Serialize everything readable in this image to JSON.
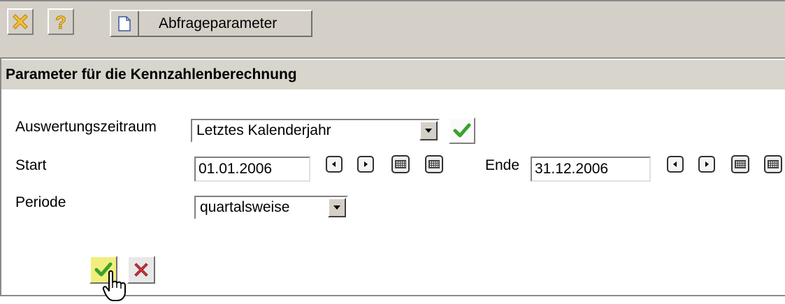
{
  "toolbar": {
    "close_icon": "close-x-icon",
    "help_icon": "help-question-icon",
    "tab_label": "Abfrageparameter"
  },
  "section": {
    "title": "Parameter für die Kennzahlenberechnung"
  },
  "form": {
    "zeitraum_label": "Auswertungszeitraum",
    "zeitraum_value": "Letztes Kalenderjahr",
    "start_label": "Start",
    "start_value": "01.01.2006",
    "ende_label": "Ende",
    "ende_value": "31.12.2006",
    "periode_label": "Periode",
    "periode_value": "quartalsweise"
  },
  "colors": {
    "toolbar_bg": "#d4d0c8",
    "header_bg": "#d8d5cc",
    "check_green": "#3aa12e",
    "cancel_red": "#d9333f",
    "confirm_bg": "#f2ee7c"
  }
}
